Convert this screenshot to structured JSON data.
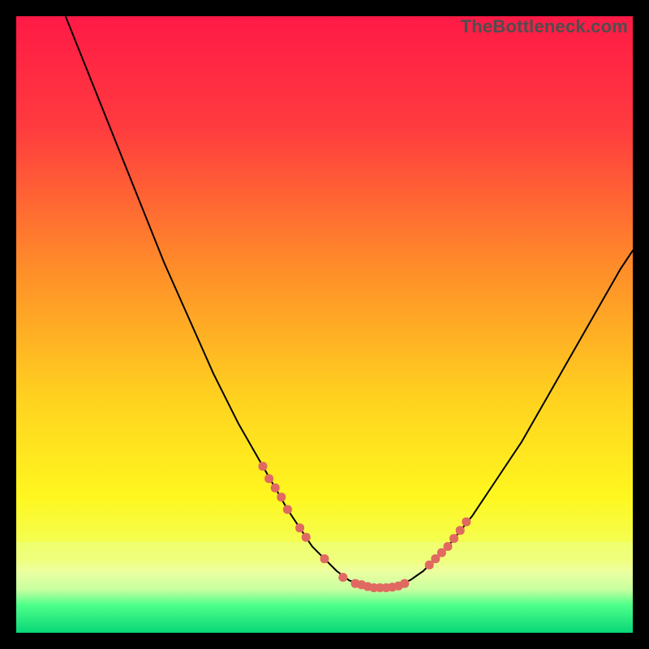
{
  "watermark": "TheBottleneck.com",
  "colors": {
    "bg": "#000000",
    "curve": "#000000",
    "marker": "#e06a61",
    "gradient_top": "#ff1a46",
    "gradient_mid1": "#ff7d2a",
    "gradient_mid2": "#ffd92a",
    "gradient_mid3": "#f6ff2a",
    "gradient_bottom_band": "#ecff87",
    "gradient_green": "#17e86b"
  },
  "chart_data": {
    "type": "line",
    "title": "",
    "xlabel": "",
    "ylabel": "",
    "xlim": [
      0,
      100
    ],
    "ylim": [
      0,
      100
    ],
    "series": [
      {
        "name": "bottleneck-curve",
        "x": [
          8,
          12,
          16,
          20,
          24,
          28,
          32,
          36,
          40,
          44,
          48,
          50,
          52,
          54,
          56,
          58,
          60,
          62,
          64,
          66,
          70,
          74,
          78,
          82,
          86,
          90,
          94,
          98,
          100
        ],
        "y": [
          100,
          90,
          80,
          70,
          60,
          51,
          42,
          34,
          27,
          20,
          14,
          12,
          10,
          8.5,
          7.8,
          7.3,
          7.3,
          7.6,
          8.6,
          10,
          14,
          19,
          25,
          31,
          38,
          45,
          52,
          59,
          62
        ]
      }
    ],
    "markers": {
      "name": "highlight-dots",
      "x": [
        40,
        41,
        42,
        43,
        44,
        46,
        47,
        50,
        53,
        55,
        56,
        57,
        58,
        59,
        60,
        61,
        62,
        63,
        67,
        68,
        69,
        70,
        71,
        72,
        73
      ],
      "y": [
        27,
        25,
        23.5,
        22,
        20,
        17,
        15.5,
        12,
        9,
        8,
        7.8,
        7.5,
        7.3,
        7.3,
        7.3,
        7.4,
        7.6,
        8.0,
        11,
        12,
        13,
        14,
        15.3,
        16.6,
        18
      ]
    }
  }
}
